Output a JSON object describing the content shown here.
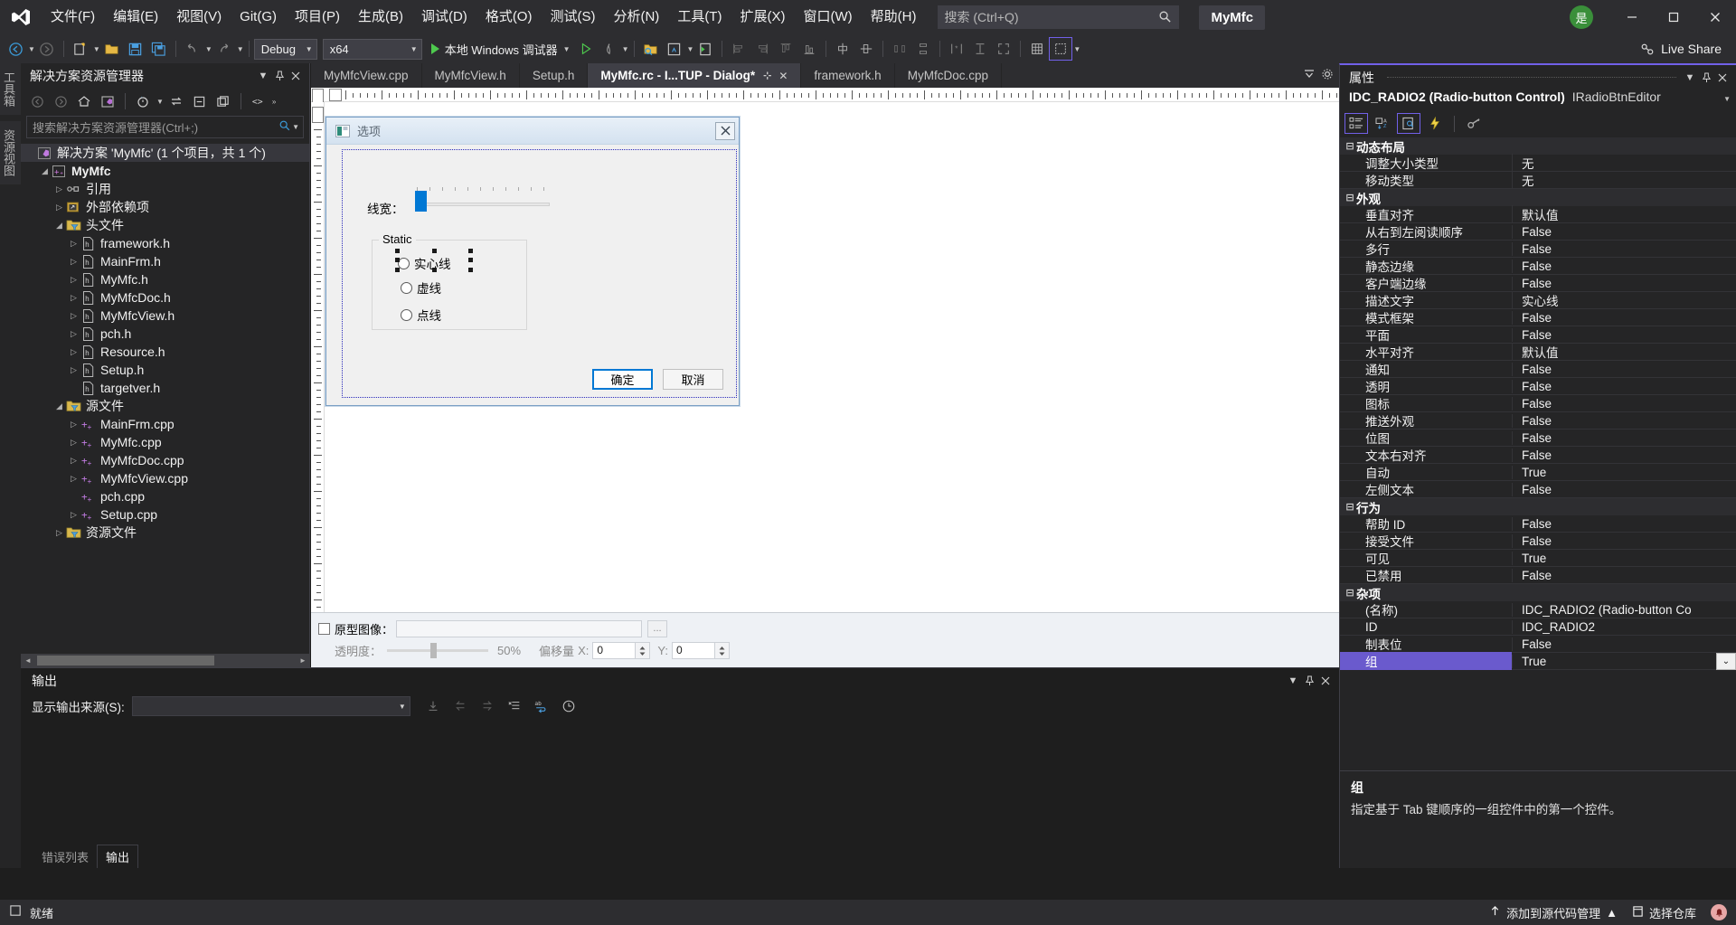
{
  "titlebar": {
    "logo_icon": "visual-studio-logo",
    "menus": [
      {
        "label": "文件(F)"
      },
      {
        "label": "编辑(E)"
      },
      {
        "label": "视图(V)"
      },
      {
        "label": "Git(G)"
      },
      {
        "label": "项目(P)"
      },
      {
        "label": "生成(B)"
      },
      {
        "label": "调试(D)"
      },
      {
        "label": "格式(O)"
      },
      {
        "label": "测试(S)"
      },
      {
        "label": "分析(N)"
      },
      {
        "label": "工具(T)"
      },
      {
        "label": "扩展(X)"
      },
      {
        "label": "窗口(W)"
      },
      {
        "label": "帮助(H)"
      }
    ],
    "search_placeholder": "搜索 (Ctrl+Q)",
    "search_icon": "search-icon",
    "project_chip": "MyMfc",
    "account_badge": "是",
    "minimize_icon": "minimize-icon",
    "maximize_icon": "maximize-icon",
    "close_icon": "close-icon"
  },
  "toolbar": {
    "back_icon": "navigate-back-icon",
    "forward_icon": "navigate-forward-icon",
    "new_item_icon": "new-item-icon",
    "open_icon": "open-file-icon",
    "save_icon": "save-icon",
    "save_all_icon": "save-all-icon",
    "undo_icon": "undo-icon",
    "redo_icon": "redo-icon",
    "config": "Debug",
    "platform": "x64",
    "run_label": "本地 Windows 调试器",
    "run_icon": "play-icon",
    "live_share_label": "Live Share",
    "live_share_icon": "live-share-icon"
  },
  "vtabs": [
    {
      "label": "工具箱"
    },
    {
      "label": "资源视图"
    }
  ],
  "solution_explorer": {
    "title": "解决方案资源管理器",
    "dropdown_icon": "chevron-down-icon",
    "pin_icon": "pin-icon",
    "close_icon": "close-icon",
    "search_placeholder": "搜索解决方案资源管理器(Ctrl+;)",
    "search_icon": "search-icon",
    "tools": [
      "back-icon",
      "forward-icon",
      "home-icon",
      "solution-icon",
      "pending-changes-icon",
      "sync-icon",
      "collapse-all-icon",
      "properties-icon",
      "code-view-icon"
    ],
    "tree": [
      {
        "depth": 0,
        "expander": "",
        "icon": "solution-icon",
        "label": "解决方案 'MyMfc' (1 个项目，共 1 个)",
        "bold": false,
        "selected": true
      },
      {
        "depth": 1,
        "expander": "expanded",
        "icon": "cpp-project-icon",
        "label": "MyMfc",
        "bold": true,
        "selected": false
      },
      {
        "depth": 2,
        "expander": "collapsed",
        "icon": "references-icon",
        "label": "引用",
        "bold": false,
        "selected": false
      },
      {
        "depth": 2,
        "expander": "collapsed",
        "icon": "external-deps-icon",
        "label": "外部依赖项",
        "bold": false,
        "selected": false
      },
      {
        "depth": 2,
        "expander": "expanded",
        "icon": "filter-folder-icon",
        "label": "头文件",
        "bold": false,
        "selected": false
      },
      {
        "depth": 3,
        "expander": "collapsed",
        "icon": "header-file-icon",
        "label": "framework.h",
        "bold": false,
        "selected": false
      },
      {
        "depth": 3,
        "expander": "collapsed",
        "icon": "header-file-icon",
        "label": "MainFrm.h",
        "bold": false,
        "selected": false
      },
      {
        "depth": 3,
        "expander": "collapsed",
        "icon": "header-file-icon",
        "label": "MyMfc.h",
        "bold": false,
        "selected": false
      },
      {
        "depth": 3,
        "expander": "collapsed",
        "icon": "header-file-icon",
        "label": "MyMfcDoc.h",
        "bold": false,
        "selected": false
      },
      {
        "depth": 3,
        "expander": "collapsed",
        "icon": "header-file-icon",
        "label": "MyMfcView.h",
        "bold": false,
        "selected": false
      },
      {
        "depth": 3,
        "expander": "collapsed",
        "icon": "header-file-icon",
        "label": "pch.h",
        "bold": false,
        "selected": false
      },
      {
        "depth": 3,
        "expander": "collapsed",
        "icon": "header-file-icon",
        "label": "Resource.h",
        "bold": false,
        "selected": false
      },
      {
        "depth": 3,
        "expander": "collapsed",
        "icon": "header-file-icon",
        "label": "Setup.h",
        "bold": false,
        "selected": false
      },
      {
        "depth": 3,
        "expander": "",
        "icon": "header-file-icon",
        "label": "targetver.h",
        "bold": false,
        "selected": false
      },
      {
        "depth": 2,
        "expander": "expanded",
        "icon": "filter-folder-icon",
        "label": "源文件",
        "bold": false,
        "selected": false
      },
      {
        "depth": 3,
        "expander": "collapsed",
        "icon": "cpp-file-icon",
        "label": "MainFrm.cpp",
        "bold": false,
        "selected": false
      },
      {
        "depth": 3,
        "expander": "collapsed",
        "icon": "cpp-file-icon",
        "label": "MyMfc.cpp",
        "bold": false,
        "selected": false
      },
      {
        "depth": 3,
        "expander": "collapsed",
        "icon": "cpp-file-icon",
        "label": "MyMfcDoc.cpp",
        "bold": false,
        "selected": false
      },
      {
        "depth": 3,
        "expander": "collapsed",
        "icon": "cpp-file-icon",
        "label": "MyMfcView.cpp",
        "bold": false,
        "selected": false
      },
      {
        "depth": 3,
        "expander": "",
        "icon": "cpp-file-icon",
        "label": "pch.cpp",
        "bold": false,
        "selected": false
      },
      {
        "depth": 3,
        "expander": "collapsed",
        "icon": "cpp-file-icon",
        "label": "Setup.cpp",
        "bold": false,
        "selected": false
      },
      {
        "depth": 2,
        "expander": "collapsed",
        "icon": "filter-folder-icon",
        "label": "资源文件",
        "bold": false,
        "selected": false
      }
    ]
  },
  "doc_tabs": {
    "tabs": [
      {
        "label": "MyMfcView.cpp",
        "active": false
      },
      {
        "label": "MyMfcView.h",
        "active": false
      },
      {
        "label": "Setup.h",
        "active": false
      },
      {
        "label": "MyMfc.rc - I...TUP - Dialog*",
        "active": true
      },
      {
        "label": "framework.h",
        "active": false
      },
      {
        "label": "MyMfcDoc.cpp",
        "active": false
      }
    ],
    "pin_icon": "pin-icon",
    "close_icon": "close-icon",
    "overflow_icon": "tab-overflow-icon",
    "settings_icon": "gear-icon"
  },
  "designer": {
    "dialog": {
      "icon": "dialog-icon",
      "title": "选项",
      "close_label": "✕",
      "line_width_label": "线宽：",
      "groupbox_label": "Static",
      "radios": [
        {
          "label": "实心线",
          "selected_handles": true
        },
        {
          "label": "虚线",
          "selected_handles": false
        },
        {
          "label": "点线",
          "selected_handles": false
        }
      ],
      "ok_button": "确定",
      "cancel_button": "取消"
    },
    "proto": {
      "image_label": "原型图像：",
      "image_value": "",
      "browse_label": "...",
      "opacity_label": "透明度：",
      "opacity_value": "50%",
      "offset_label": "偏移量",
      "offset_x_label": "X:",
      "offset_x_value": "0",
      "offset_y_label": "Y:",
      "offset_y_value": "0"
    }
  },
  "output": {
    "title": "输出",
    "dropdown_icon": "chevron-down-icon",
    "pin_icon": "pin-icon",
    "close_icon": "close-icon",
    "source_label": "显示输出来源(S):",
    "source_value": "",
    "tools": [
      "jump-to-icon",
      "prev-icon",
      "next-icon",
      "clear-all-icon",
      "word-wrap-icon",
      "history-icon"
    ],
    "tabs": [
      {
        "label": "错误列表",
        "active": false
      },
      {
        "label": "输出",
        "active": true
      }
    ]
  },
  "properties": {
    "title": "属性",
    "dropdown_icon": "chevron-down-icon",
    "pin_icon": "pin-icon",
    "close_icon": "close-icon",
    "object_name": "IDC_RADIO2 (Radio-button Control)",
    "editor_name": "IRadioBtnEditor",
    "tools": [
      {
        "icon": "categorized-icon",
        "on": true
      },
      {
        "icon": "alphabetical-icon",
        "on": false
      },
      {
        "icon": "properties-page-icon",
        "on": true
      },
      {
        "icon": "events-icon",
        "on": false
      },
      {
        "icon": "property-pages-icon",
        "on": false
      }
    ],
    "groups": [
      {
        "name": "动态布局",
        "rows": [
          {
            "name": "调整大小类型",
            "value": "无"
          },
          {
            "name": "移动类型",
            "value": "无"
          }
        ]
      },
      {
        "name": "外观",
        "rows": [
          {
            "name": "垂直对齐",
            "value": "默认值"
          },
          {
            "name": "从右到左阅读顺序",
            "value": "False"
          },
          {
            "name": "多行",
            "value": "False"
          },
          {
            "name": "静态边缘",
            "value": "False"
          },
          {
            "name": "客户端边缘",
            "value": "False"
          },
          {
            "name": "描述文字",
            "value": "实心线"
          },
          {
            "name": "模式框架",
            "value": "False"
          },
          {
            "name": "平面",
            "value": "False"
          },
          {
            "name": "水平对齐",
            "value": "默认值"
          },
          {
            "name": "通知",
            "value": "False"
          },
          {
            "name": "透明",
            "value": "False"
          },
          {
            "name": "图标",
            "value": "False"
          },
          {
            "name": "推送外观",
            "value": "False"
          },
          {
            "name": "位图",
            "value": "False"
          },
          {
            "name": "文本右对齐",
            "value": "False"
          },
          {
            "name": "自动",
            "value": "True"
          },
          {
            "name": "左侧文本",
            "value": "False"
          }
        ]
      },
      {
        "name": "行为",
        "rows": [
          {
            "name": "帮助 ID",
            "value": "False"
          },
          {
            "name": "接受文件",
            "value": "False"
          },
          {
            "name": "可见",
            "value": "True"
          },
          {
            "name": "已禁用",
            "value": "False"
          }
        ]
      },
      {
        "name": "杂项",
        "rows": [
          {
            "name": "(名称)",
            "value": "IDC_RADIO2 (Radio-button Co"
          },
          {
            "name": "ID",
            "value": "IDC_RADIO2"
          },
          {
            "name": "制表位",
            "value": "False"
          },
          {
            "name": "组",
            "value": "True",
            "selected": true,
            "has_dropdown": true
          }
        ]
      }
    ],
    "description": {
      "title": "组",
      "text": "指定基于 Tab 键顺序的一组控件中的第一个控件。"
    }
  },
  "statusbar": {
    "ready_icon": "ready-icon",
    "ready_label": "就绪",
    "source_control_icon": "upload-icon",
    "source_control_label": "添加到源代码管理",
    "source_control_caret": "▲",
    "repo_icon": "repository-icon",
    "repo_label": "选择仓库",
    "notify_icon": "bell-icon"
  },
  "colors": {
    "accent_purple": "#7160e8",
    "selection_purple": "#6a5acd",
    "chrome_bg": "#2d2d30",
    "panel_bg": "#252526",
    "editor_bg": "#1e1e1e",
    "dialog_blue": "#0078d4"
  }
}
